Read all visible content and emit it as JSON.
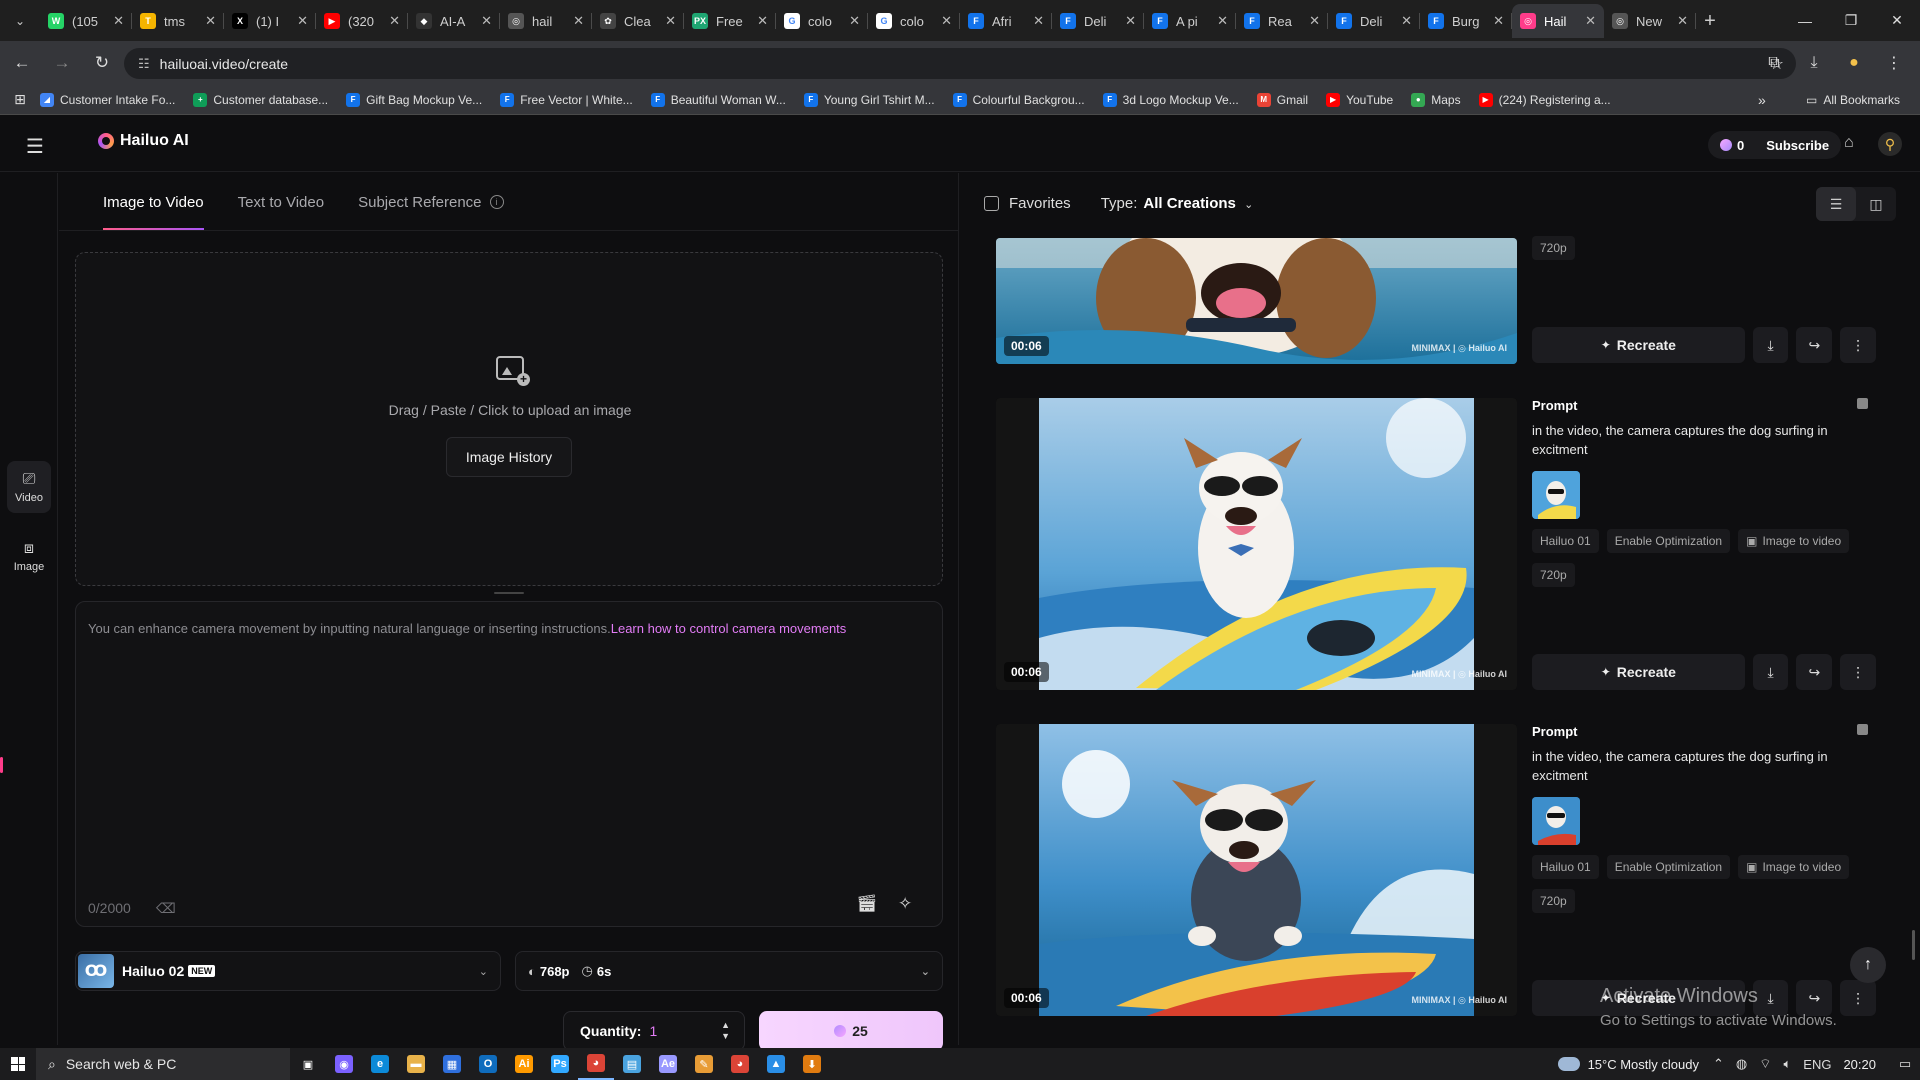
{
  "browser": {
    "tabs": [
      {
        "label": "(105",
        "icon": "whatsapp-icon",
        "color": "#25d366",
        "glyph": "W"
      },
      {
        "label": "tms",
        "icon": "tms-icon",
        "color": "#f4b400",
        "glyph": "T"
      },
      {
        "label": "(1) I",
        "icon": "x-icon",
        "color": "#000000",
        "glyph": "X"
      },
      {
        "label": "(320",
        "icon": "youtube-icon",
        "color": "#ff0000",
        "glyph": "▶"
      },
      {
        "label": "AI-A",
        "icon": "ai-icon",
        "color": "#333333",
        "glyph": "◆"
      },
      {
        "label": "hail",
        "icon": "globe-icon",
        "color": "#555555",
        "glyph": "◎"
      },
      {
        "label": "Clea",
        "icon": "openai-icon",
        "color": "#444444",
        "glyph": "✿"
      },
      {
        "label": "Free",
        "icon": "freepik-px-icon",
        "color": "#1ea672",
        "glyph": "PX"
      },
      {
        "label": "colo",
        "icon": "google-icon",
        "color": "#ffffff",
        "glyph": "G"
      },
      {
        "label": "colo",
        "icon": "google-icon",
        "color": "#ffffff",
        "glyph": "G"
      },
      {
        "label": "Afri",
        "icon": "freepik-icon",
        "color": "#1273eb",
        "glyph": "F"
      },
      {
        "label": "Deli",
        "icon": "freepik-icon",
        "color": "#1273eb",
        "glyph": "F"
      },
      {
        "label": "A pi",
        "icon": "freepik-icon",
        "color": "#1273eb",
        "glyph": "F"
      },
      {
        "label": "Rea",
        "icon": "freepik-icon",
        "color": "#1273eb",
        "glyph": "F"
      },
      {
        "label": "Deli",
        "icon": "freepik-icon",
        "color": "#1273eb",
        "glyph": "F"
      },
      {
        "label": "Burg",
        "icon": "freepik-icon",
        "color": "#1273eb",
        "glyph": "F"
      },
      {
        "label": "Hail",
        "icon": "hailuo-icon",
        "color": "#ff3c8a",
        "glyph": "◎",
        "active": true
      },
      {
        "label": "New",
        "icon": "globe-icon",
        "color": "#555555",
        "glyph": "◎"
      }
    ],
    "url": "hailuoai.video/create",
    "bookmarks": [
      {
        "label": "Customer Intake Fo...",
        "color": "#4285f4",
        "glyph": "◢"
      },
      {
        "label": "Customer database...",
        "color": "#0f9d58",
        "glyph": "+"
      },
      {
        "label": "Gift Bag Mockup Ve...",
        "color": "#1273eb",
        "glyph": "F"
      },
      {
        "label": "Free Vector | White...",
        "color": "#1273eb",
        "glyph": "F"
      },
      {
        "label": "Beautiful Woman W...",
        "color": "#1273eb",
        "glyph": "F"
      },
      {
        "label": "Young Girl Tshirt M...",
        "color": "#1273eb",
        "glyph": "F"
      },
      {
        "label": "Colourful Backgrou...",
        "color": "#1273eb",
        "glyph": "F"
      },
      {
        "label": "3d Logo Mockup Ve...",
        "color": "#1273eb",
        "glyph": "F"
      },
      {
        "label": "Gmail",
        "color": "#ea4335",
        "glyph": "M"
      },
      {
        "label": "YouTube",
        "color": "#ff0000",
        "glyph": "▶"
      },
      {
        "label": "Maps",
        "color": "#34a853",
        "glyph": "●"
      },
      {
        "label": "(224) Registering a...",
        "color": "#ff0000",
        "glyph": "▶"
      }
    ],
    "all_bookmarks": "All Bookmarks"
  },
  "app": {
    "brand": "Hailuo AI",
    "credits": "0",
    "subscribe": "Subscribe",
    "rail": [
      {
        "label": "Video",
        "icon": "video-icon"
      },
      {
        "label": "Image",
        "icon": "image-icon"
      }
    ],
    "mode_tabs": [
      "Image to Video",
      "Text to Video",
      "Subject Reference"
    ],
    "upload_hint": "Drag / Paste / Click to upload an image",
    "image_history": "Image History",
    "prompt_placeholder": "You can enhance camera movement by inputting natural language or inserting instructions.",
    "prompt_link": "Learn how to control camera movements",
    "char_count": "0/2000",
    "model_name": "Hailuo 02",
    "model_badge": "NEW",
    "resolution": "768p",
    "duration": "6s",
    "quantity_label": "Quantity:",
    "quantity_value": "1",
    "generate_cost": "25",
    "favorites": "Favorites",
    "type_label": "Type:",
    "type_value": "All Creations",
    "cards": [
      {
        "duration": "00:06",
        "watermark": "MINIMAX | ◎ Hailuo AI",
        "res": "720p",
        "recreate": "Recreate"
      },
      {
        "duration": "00:06",
        "watermark": "MINIMAX | ◎ Hailuo AI",
        "prompt_label": "Prompt",
        "prompt": "in the video, the camera captures the dog surfing in excitment",
        "tags": [
          "Hailuo 01",
          "Enable Optimization",
          "Image to video"
        ],
        "res": "720p",
        "recreate": "Recreate"
      },
      {
        "duration": "00:06",
        "watermark": "MINIMAX | ◎ Hailuo AI",
        "prompt_label": "Prompt",
        "prompt": "in the video, the camera captures the dog surfing in excitment",
        "tags": [
          "Hailuo 01",
          "Enable Optimization",
          "Image to video"
        ],
        "res": "720p",
        "recreate": "Recreate"
      }
    ],
    "activate_title": "Activate Windows",
    "activate_sub": "Go to Settings to activate Windows."
  },
  "taskbar": {
    "search_placeholder": "Search web & PC",
    "weather": "15°C  Mostly cloudy",
    "lang": "ENG",
    "time": "20:20",
    "apps": [
      {
        "name": "task-view-icon",
        "glyph": "▣",
        "color": "transparent"
      },
      {
        "name": "copilot-icon",
        "glyph": "◉",
        "color": "#7b61ff"
      },
      {
        "name": "edge-icon",
        "glyph": "e",
        "color": "#0c8ad8"
      },
      {
        "name": "file-explorer-icon",
        "glyph": "▬",
        "color": "#e8b24a"
      },
      {
        "name": "store-icon",
        "glyph": "▦",
        "color": "#2f6fdd"
      },
      {
        "name": "outlook-icon",
        "glyph": "O",
        "color": "#0f6cbd"
      },
      {
        "name": "illustrator-icon",
        "glyph": "Ai",
        "color": "#ff9a00"
      },
      {
        "name": "photoshop-icon",
        "glyph": "Ps",
        "color": "#31a8ff"
      },
      {
        "name": "chrome-icon",
        "glyph": "◕",
        "color": "#db4437",
        "active": true
      },
      {
        "name": "notepad-icon",
        "glyph": "▤",
        "color": "#4aa3df"
      },
      {
        "name": "after-effects-icon",
        "glyph": "Ae",
        "color": "#9999ff"
      },
      {
        "name": "paint-icon",
        "glyph": "✎",
        "color": "#e89c36"
      },
      {
        "name": "chrome-alt-icon",
        "glyph": "◕",
        "color": "#db4437"
      },
      {
        "name": "photos-icon",
        "glyph": "▲",
        "color": "#2a8ee6"
      },
      {
        "name": "download-manager-icon",
        "glyph": "⬇",
        "color": "#e07b10"
      }
    ]
  }
}
